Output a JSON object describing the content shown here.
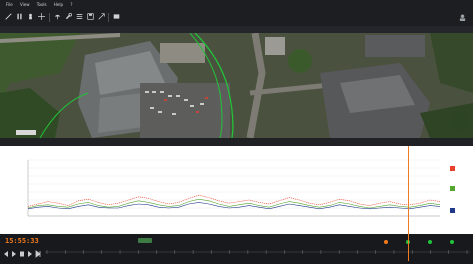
{
  "app": {
    "menu": [
      "File",
      "View",
      "Tools",
      "Help",
      "?"
    ],
    "toolbar_label": "",
    "map_panel_title": "",
    "map_status_text": "",
    "map_credit": ""
  },
  "map": {
    "track_color": "#22c23a"
  },
  "chart": {
    "title": "",
    "legend": [
      {
        "label": "",
        "color": "#e8412b"
      },
      {
        "label": "",
        "color": "#55a630"
      },
      {
        "label": "",
        "color": "#203a8a"
      }
    ]
  },
  "chart_data": {
    "type": "line",
    "title": "",
    "xlabel": "",
    "ylabel": "",
    "yticks": [
      "",
      "",
      "",
      "",
      "",
      "",
      "",
      ""
    ],
    "xticks": [
      "",
      "",
      "",
      "",
      "",
      "",
      "",
      "",
      "",
      "",
      "",
      "",
      "",
      "",
      "",
      "",
      "",
      "",
      "",
      "",
      "",
      ""
    ],
    "series": [
      {
        "color": "#e8412b",
        "values": [
          1.2,
          1.5,
          1.8,
          1.6,
          1.3,
          1.9,
          2.1,
          1.7,
          1.4,
          1.6,
          2.0,
          2.4,
          2.2,
          1.8,
          1.5,
          1.7,
          2.2,
          2.6,
          2.3,
          1.9,
          1.6,
          1.8,
          2.0,
          1.7,
          1.5,
          1.9,
          2.3,
          2.0,
          1.6,
          1.4,
          1.7,
          2.1,
          1.9,
          1.5,
          1.3,
          1.6,
          1.8,
          1.5,
          1.4,
          1.6,
          2.0,
          1.8
        ]
      },
      {
        "color": "#55a630",
        "values": [
          1.0,
          1.3,
          1.4,
          1.2,
          1.1,
          1.5,
          1.7,
          1.3,
          1.1,
          1.2,
          1.6,
          1.9,
          1.7,
          1.4,
          1.2,
          1.3,
          1.8,
          2.1,
          1.9,
          1.5,
          1.2,
          1.4,
          1.6,
          1.3,
          1.1,
          1.5,
          1.8,
          1.6,
          1.3,
          1.1,
          1.3,
          1.7,
          1.5,
          1.2,
          1.0,
          1.2,
          1.4,
          1.2,
          1.1,
          1.3,
          1.6,
          1.4
        ]
      },
      {
        "color": "#203a8a",
        "values": [
          0.9,
          1.1,
          1.2,
          1.0,
          0.9,
          1.2,
          1.4,
          1.1,
          1.0,
          1.0,
          1.3,
          1.5,
          1.4,
          1.1,
          1.0,
          1.1,
          1.5,
          1.7,
          1.5,
          1.2,
          1.0,
          1.1,
          1.3,
          1.1,
          0.9,
          1.2,
          1.5,
          1.3,
          1.1,
          0.9,
          1.1,
          1.4,
          1.2,
          1.0,
          0.9,
          1.0,
          1.1,
          1.0,
          0.9,
          1.1,
          1.3,
          1.2
        ]
      }
    ],
    "ylim": [
      0,
      7
    ],
    "cursor_position": 0.88,
    "grid": true
  },
  "player": {
    "timestamp": "15:55:33",
    "readout": "",
    "badge": "",
    "status_dots": [
      "#f27a1d",
      "#22c23a",
      "#22c23a",
      "#22c23a"
    ],
    "timeline_ticks": [
      "",
      "",
      "",
      "",
      "",
      "",
      "",
      "",
      "",
      "",
      "",
      "",
      "",
      "",
      "",
      "",
      "",
      "",
      "",
      "",
      "",
      "",
      "",
      ""
    ]
  }
}
